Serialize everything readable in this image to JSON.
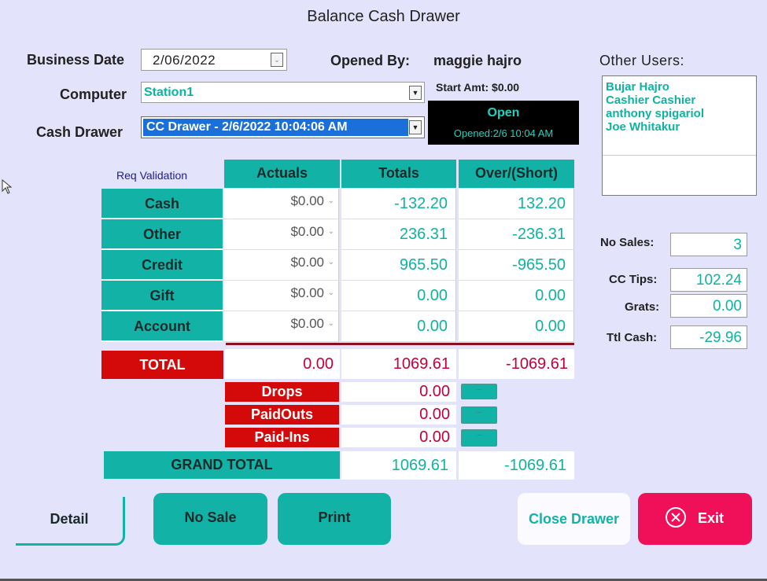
{
  "window": {
    "title": "Balance Cash Drawer"
  },
  "header": {
    "business_date_label": "Business Date",
    "business_date_value": "2/06/2022",
    "computer_label": "Computer",
    "computer_value": "Station1",
    "cash_drawer_label": "Cash Drawer",
    "cash_drawer_value": "CC Drawer - 2/6/2022 10:04:06 AM",
    "opened_by_label": "Opened By:",
    "opened_by_value": "maggie hajro",
    "start_amt": "Start Amt: $0.00",
    "status": "Open",
    "opened_text": "Opened:2/6 10:04 AM",
    "other_users_label": "Other Users:",
    "other_users": [
      "Bujar  Hajro",
      "Cashier Cashier",
      "anthony spigariol",
      "Joe Whitakur"
    ]
  },
  "table": {
    "req_validation": "Req Validation",
    "headers": [
      "Actuals",
      "Totals",
      "Over/(Short)"
    ],
    "rows": [
      {
        "label": "Cash",
        "actual": "$0.00",
        "total": "-132.20",
        "over": "132.20"
      },
      {
        "label": "Other",
        "actual": "$0.00",
        "total": "236.31",
        "over": "-236.31"
      },
      {
        "label": "Credit",
        "actual": "$0.00",
        "total": "965.50",
        "over": "-965.50"
      },
      {
        "label": "Gift",
        "actual": "$0.00",
        "total": "0.00",
        "over": "0.00"
      },
      {
        "label": "Account",
        "actual": "$0.00",
        "total": "0.00",
        "over": "0.00"
      }
    ],
    "total": {
      "label": "TOTAL",
      "actual": "0.00",
      "total": "1069.61",
      "over": "-1069.61"
    },
    "adjustments": [
      {
        "label": "Drops",
        "value": "0.00",
        "button": "..."
      },
      {
        "label": "PaidOuts",
        "value": "0.00",
        "button": "..."
      },
      {
        "label": "Paid-Ins",
        "value": "0.00",
        "button": "..."
      }
    ],
    "grand_total": {
      "label": "GRAND TOTAL",
      "total": "1069.61",
      "over": "-1069.61"
    }
  },
  "side": {
    "no_sales_label": "No Sales:",
    "no_sales_value": "3",
    "cc_tips_label": "CC Tips:",
    "cc_tips_value": "102.24",
    "grats_label": "Grats:",
    "grats_value": "0.00",
    "ttl_cash_label": "Ttl Cash:",
    "ttl_cash_value": "-29.96"
  },
  "buttons": {
    "detail": "Detail",
    "no_sale": "No Sale",
    "print": "Print",
    "close_drawer": "Close Drawer",
    "exit": "Exit"
  },
  "colors": {
    "background": "#e3e3fb",
    "teal": "#12b3a6",
    "red": "#d40a0a",
    "exit": "#f0105a"
  }
}
